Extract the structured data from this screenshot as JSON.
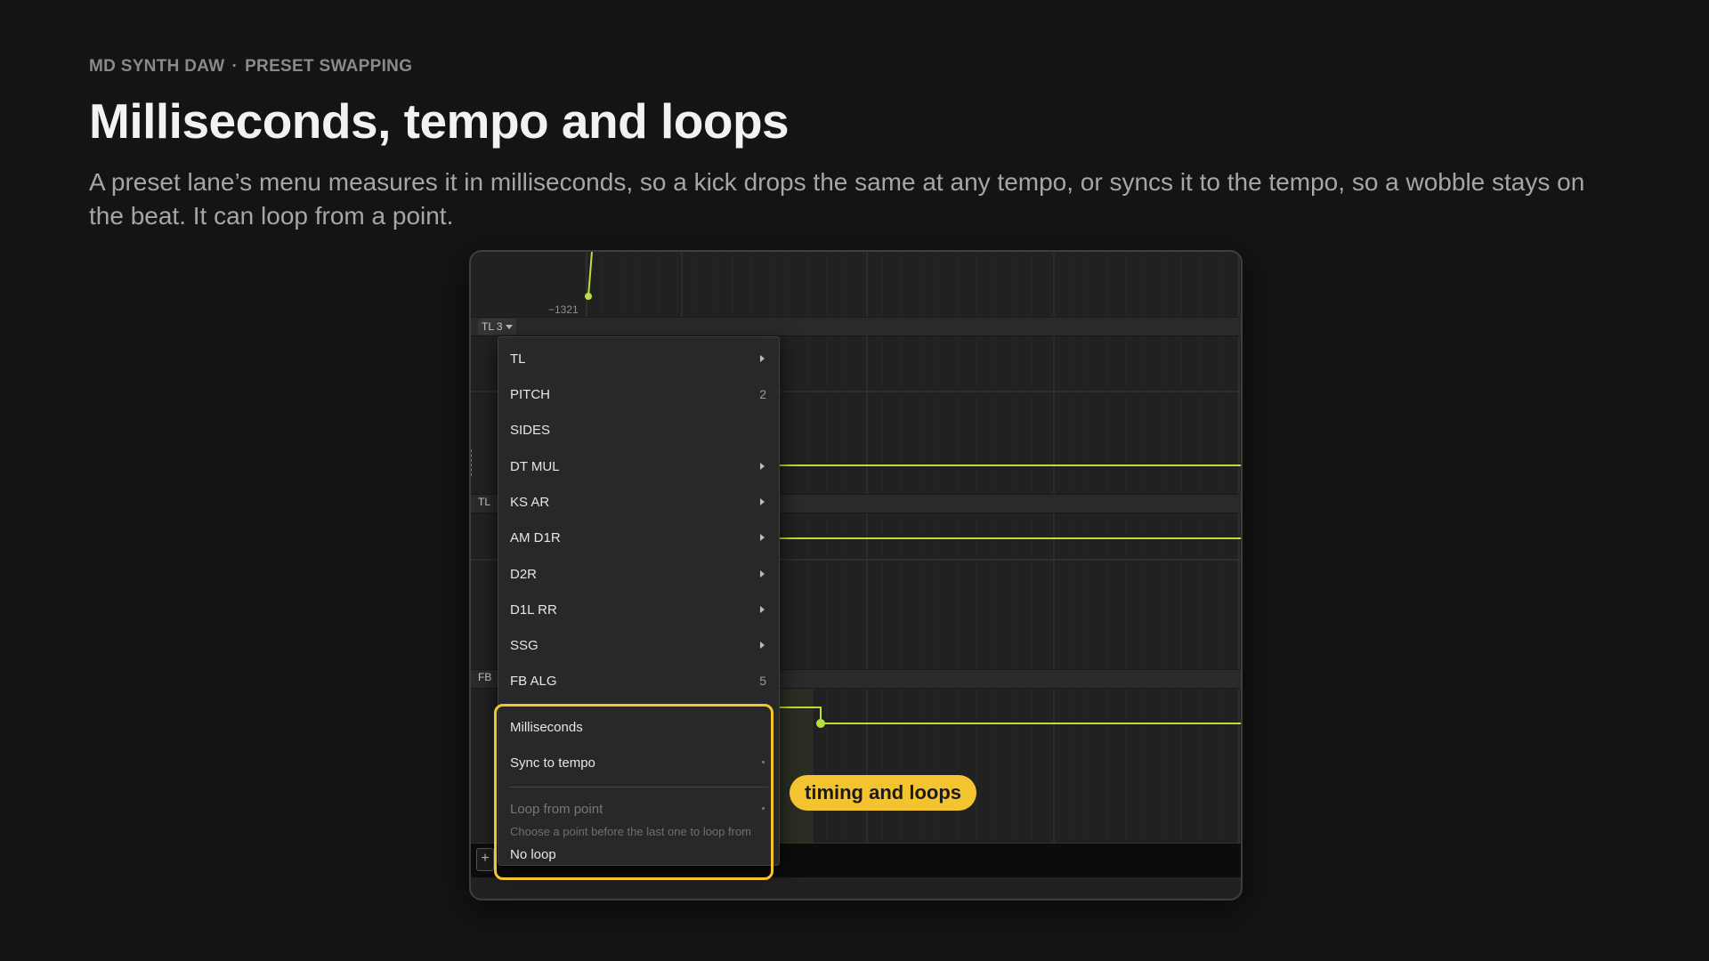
{
  "header": {
    "eyebrow_app": "MD SYNTH DAW",
    "eyebrow_sep": "·",
    "eyebrow_section": "PRESET SWAPPING",
    "title": "Milliseconds, tempo and loops",
    "description": "A preset lane’s menu measures it in milliseconds, so a kick drops the same at any tempo, or syncs it to the tempo, so a wobble stays on the beat. It can loop from a point."
  },
  "daw": {
    "value_readout": "−1321",
    "lane_button_label": "TL 3",
    "lane_labels": [
      "TL",
      "FB"
    ],
    "add_lane_label": "+"
  },
  "menu": {
    "params": [
      {
        "label": "TL",
        "submenu": true
      },
      {
        "label": "PITCH",
        "count": "2"
      },
      {
        "label": "SIDES"
      },
      {
        "label": "DT MUL",
        "submenu": true
      },
      {
        "label": "KS AR",
        "submenu": true
      },
      {
        "label": "AM D1R",
        "submenu": true
      },
      {
        "label": "D2R",
        "submenu": true
      },
      {
        "label": "D1L RR",
        "submenu": true
      },
      {
        "label": "SSG",
        "submenu": true
      },
      {
        "label": "FB ALG",
        "count": "5"
      }
    ],
    "timing": {
      "milliseconds": "Milliseconds",
      "sync_to_tempo": "Sync to tempo"
    },
    "loop": {
      "loop_from_point": "Loop from point",
      "hint": "Choose a point before the last one to loop from",
      "no_loop": "No loop"
    }
  },
  "callout": "timing and loops",
  "colors": {
    "accent": "#f4c430",
    "curve": "#b7e13a",
    "background": "#141414"
  }
}
